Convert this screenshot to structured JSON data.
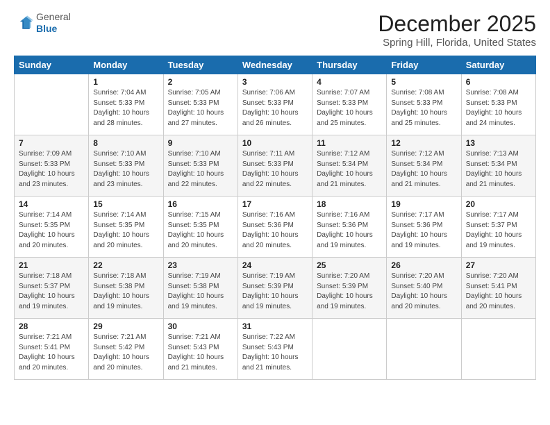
{
  "header": {
    "logo_general": "General",
    "logo_blue": "Blue",
    "main_title": "December 2025",
    "subtitle": "Spring Hill, Florida, United States"
  },
  "days_of_week": [
    "Sunday",
    "Monday",
    "Tuesday",
    "Wednesday",
    "Thursday",
    "Friday",
    "Saturday"
  ],
  "weeks": [
    [
      {
        "day": "",
        "info": ""
      },
      {
        "day": "1",
        "info": "Sunrise: 7:04 AM\nSunset: 5:33 PM\nDaylight: 10 hours\nand 28 minutes."
      },
      {
        "day": "2",
        "info": "Sunrise: 7:05 AM\nSunset: 5:33 PM\nDaylight: 10 hours\nand 27 minutes."
      },
      {
        "day": "3",
        "info": "Sunrise: 7:06 AM\nSunset: 5:33 PM\nDaylight: 10 hours\nand 26 minutes."
      },
      {
        "day": "4",
        "info": "Sunrise: 7:07 AM\nSunset: 5:33 PM\nDaylight: 10 hours\nand 25 minutes."
      },
      {
        "day": "5",
        "info": "Sunrise: 7:08 AM\nSunset: 5:33 PM\nDaylight: 10 hours\nand 25 minutes."
      },
      {
        "day": "6",
        "info": "Sunrise: 7:08 AM\nSunset: 5:33 PM\nDaylight: 10 hours\nand 24 minutes."
      }
    ],
    [
      {
        "day": "7",
        "info": "Sunrise: 7:09 AM\nSunset: 5:33 PM\nDaylight: 10 hours\nand 23 minutes."
      },
      {
        "day": "8",
        "info": "Sunrise: 7:10 AM\nSunset: 5:33 PM\nDaylight: 10 hours\nand 23 minutes."
      },
      {
        "day": "9",
        "info": "Sunrise: 7:10 AM\nSunset: 5:33 PM\nDaylight: 10 hours\nand 22 minutes."
      },
      {
        "day": "10",
        "info": "Sunrise: 7:11 AM\nSunset: 5:33 PM\nDaylight: 10 hours\nand 22 minutes."
      },
      {
        "day": "11",
        "info": "Sunrise: 7:12 AM\nSunset: 5:34 PM\nDaylight: 10 hours\nand 21 minutes."
      },
      {
        "day": "12",
        "info": "Sunrise: 7:12 AM\nSunset: 5:34 PM\nDaylight: 10 hours\nand 21 minutes."
      },
      {
        "day": "13",
        "info": "Sunrise: 7:13 AM\nSunset: 5:34 PM\nDaylight: 10 hours\nand 21 minutes."
      }
    ],
    [
      {
        "day": "14",
        "info": "Sunrise: 7:14 AM\nSunset: 5:35 PM\nDaylight: 10 hours\nand 20 minutes."
      },
      {
        "day": "15",
        "info": "Sunrise: 7:14 AM\nSunset: 5:35 PM\nDaylight: 10 hours\nand 20 minutes."
      },
      {
        "day": "16",
        "info": "Sunrise: 7:15 AM\nSunset: 5:35 PM\nDaylight: 10 hours\nand 20 minutes."
      },
      {
        "day": "17",
        "info": "Sunrise: 7:16 AM\nSunset: 5:36 PM\nDaylight: 10 hours\nand 20 minutes."
      },
      {
        "day": "18",
        "info": "Sunrise: 7:16 AM\nSunset: 5:36 PM\nDaylight: 10 hours\nand 19 minutes."
      },
      {
        "day": "19",
        "info": "Sunrise: 7:17 AM\nSunset: 5:36 PM\nDaylight: 10 hours\nand 19 minutes."
      },
      {
        "day": "20",
        "info": "Sunrise: 7:17 AM\nSunset: 5:37 PM\nDaylight: 10 hours\nand 19 minutes."
      }
    ],
    [
      {
        "day": "21",
        "info": "Sunrise: 7:18 AM\nSunset: 5:37 PM\nDaylight: 10 hours\nand 19 minutes."
      },
      {
        "day": "22",
        "info": "Sunrise: 7:18 AM\nSunset: 5:38 PM\nDaylight: 10 hours\nand 19 minutes."
      },
      {
        "day": "23",
        "info": "Sunrise: 7:19 AM\nSunset: 5:38 PM\nDaylight: 10 hours\nand 19 minutes."
      },
      {
        "day": "24",
        "info": "Sunrise: 7:19 AM\nSunset: 5:39 PM\nDaylight: 10 hours\nand 19 minutes."
      },
      {
        "day": "25",
        "info": "Sunrise: 7:20 AM\nSunset: 5:39 PM\nDaylight: 10 hours\nand 19 minutes."
      },
      {
        "day": "26",
        "info": "Sunrise: 7:20 AM\nSunset: 5:40 PM\nDaylight: 10 hours\nand 20 minutes."
      },
      {
        "day": "27",
        "info": "Sunrise: 7:20 AM\nSunset: 5:41 PM\nDaylight: 10 hours\nand 20 minutes."
      }
    ],
    [
      {
        "day": "28",
        "info": "Sunrise: 7:21 AM\nSunset: 5:41 PM\nDaylight: 10 hours\nand 20 minutes."
      },
      {
        "day": "29",
        "info": "Sunrise: 7:21 AM\nSunset: 5:42 PM\nDaylight: 10 hours\nand 20 minutes."
      },
      {
        "day": "30",
        "info": "Sunrise: 7:21 AM\nSunset: 5:43 PM\nDaylight: 10 hours\nand 21 minutes."
      },
      {
        "day": "31",
        "info": "Sunrise: 7:22 AM\nSunset: 5:43 PM\nDaylight: 10 hours\nand 21 minutes."
      },
      {
        "day": "",
        "info": ""
      },
      {
        "day": "",
        "info": ""
      },
      {
        "day": "",
        "info": ""
      }
    ]
  ]
}
